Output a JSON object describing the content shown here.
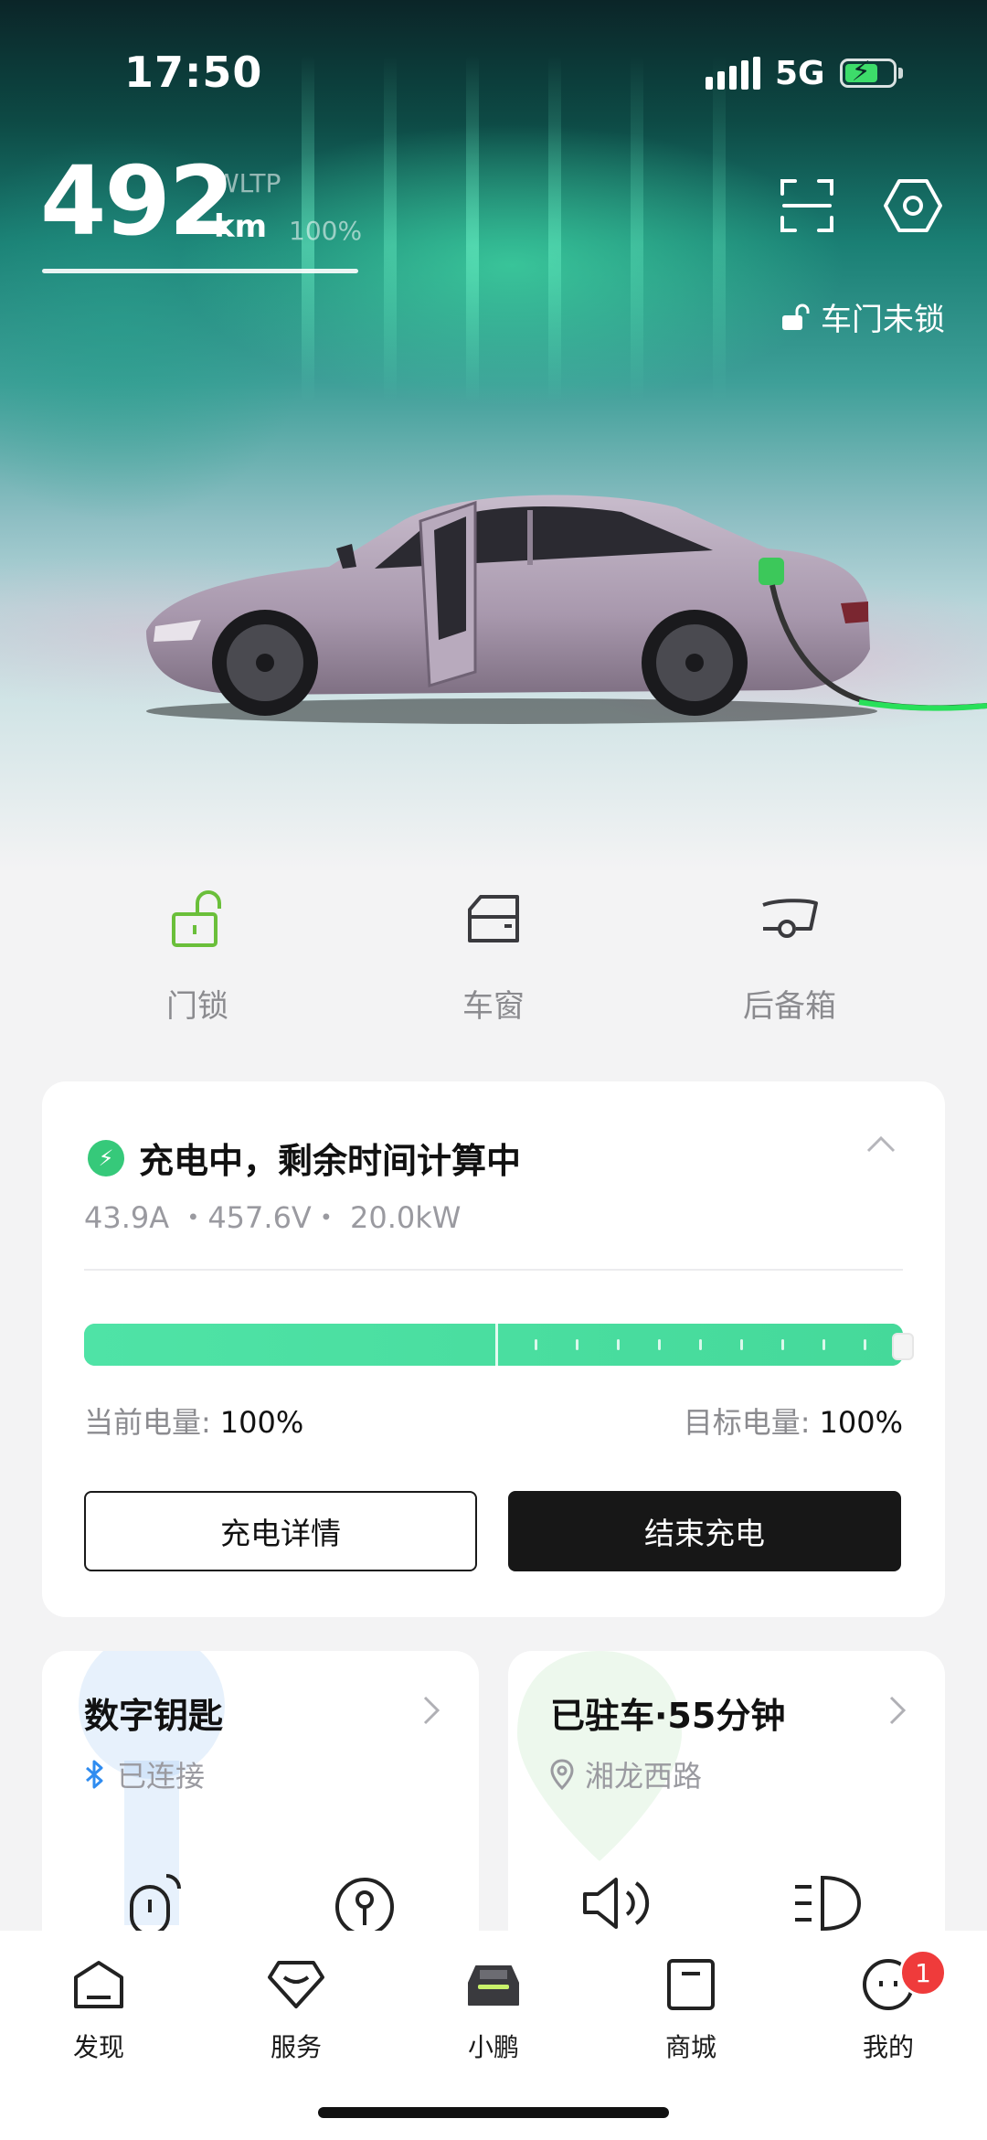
{
  "status_bar": {
    "time": "17:50",
    "network": "5G",
    "battery_charging": true
  },
  "header": {
    "range_value": "492",
    "range_standard": "WLTP",
    "range_unit": "km",
    "battery_percent": "100%",
    "scan_icon": "scan-icon",
    "settings_icon": "settings-hexagon-icon",
    "door_status": "车门未锁",
    "door_status_icon": "unlock-icon"
  },
  "quick_controls": [
    {
      "label": "门锁",
      "icon": "lock-open-icon"
    },
    {
      "label": "车窗",
      "icon": "car-window-icon"
    },
    {
      "label": "后备箱",
      "icon": "trunk-icon"
    }
  ],
  "charging": {
    "title": "充电中，剩余时间计算中",
    "stats": "43.9A ・457.6V・ 20.0kW",
    "current_soc_label": "当前电量:",
    "current_soc": "100%",
    "target_soc_label": "目标电量:",
    "target_soc": "100%",
    "current_soc_fraction": 1.0,
    "details_button": "充电详情",
    "stop_button": "结束充电"
  },
  "digital_key": {
    "title": "数字钥匙",
    "status": "已连接"
  },
  "parking": {
    "title": "已驻车·55分钟",
    "location": "湘龙西路"
  },
  "tabs": [
    {
      "label": "发现",
      "icon": "discover-icon"
    },
    {
      "label": "服务",
      "icon": "service-icon"
    },
    {
      "label": "小鹏",
      "icon": "car-icon",
      "active": true
    },
    {
      "label": "商城",
      "icon": "shop-icon"
    },
    {
      "label": "我的",
      "icon": "profile-icon",
      "badge": "1"
    }
  ],
  "colors": {
    "accent_green": "#45d99a",
    "charge_green": "#36c97a",
    "badge_red": "#ef3b3b",
    "bluetooth_blue": "#2f8cf0"
  }
}
